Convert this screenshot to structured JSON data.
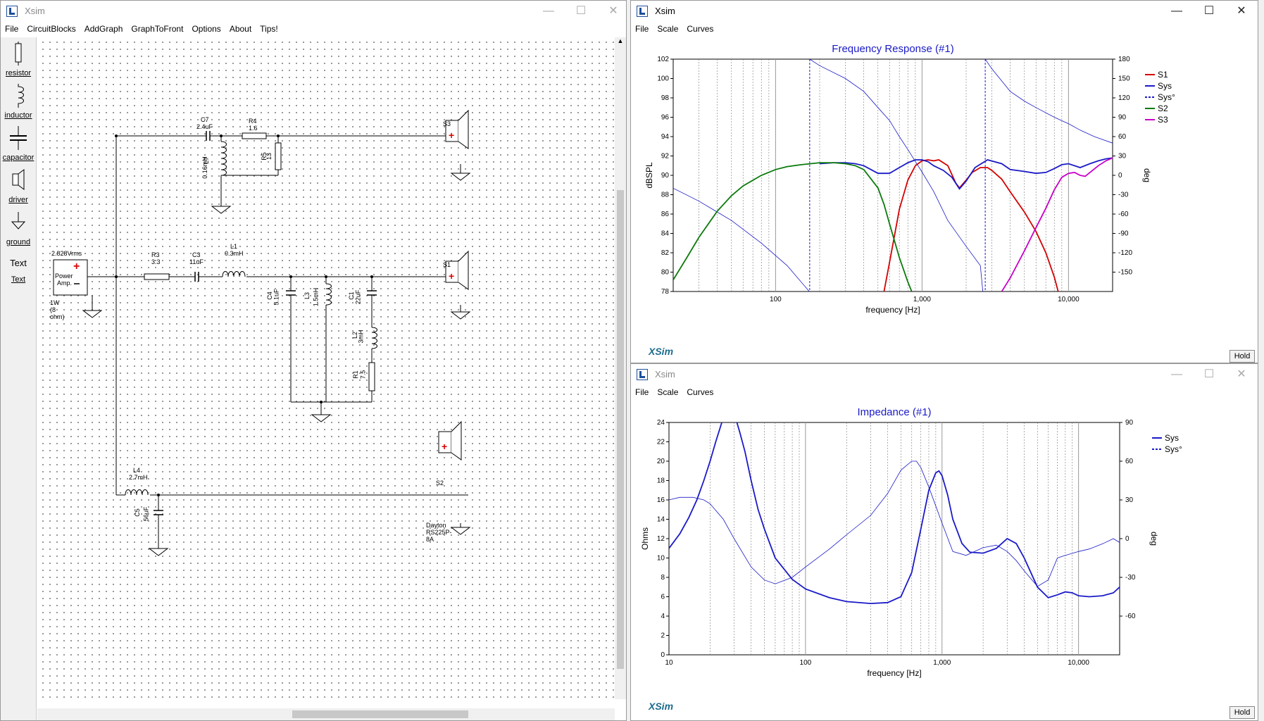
{
  "main_window": {
    "title": "Xsim",
    "menu": [
      "File",
      "CircuitBlocks",
      "AddGraph",
      "GraphToFront",
      "Options",
      "About",
      "Tips!"
    ]
  },
  "palette": [
    {
      "label": "resistor",
      "icon": "resistor-icon"
    },
    {
      "label": "inductor",
      "icon": "inductor-icon"
    },
    {
      "label": "capacitor",
      "icon": "capacitor-icon"
    },
    {
      "label": "driver",
      "icon": "driver-icon"
    },
    {
      "label": "ground",
      "icon": "ground-icon"
    },
    {
      "label": "Text",
      "icon": "text-icon",
      "glyph": "Text"
    }
  ],
  "circuit": {
    "source": {
      "voltage": "2.828Vrms",
      "name_line1": "Power",
      "name_line2": "Amp.",
      "note": "1W (8 ohm)"
    },
    "components": {
      "C7": {
        "name": "C7",
        "value": "2.4uF"
      },
      "R4": {
        "name": "R4",
        "value": "1.6"
      },
      "L7": {
        "name": "L7",
        "value": "0.16mH"
      },
      "R5": {
        "name": "R5",
        "value": "13"
      },
      "R3": {
        "name": "R3",
        "value": "3.3"
      },
      "C3": {
        "name": "C3",
        "value": "11uF"
      },
      "L1": {
        "name": "L1",
        "value": "0.3mH"
      },
      "C4": {
        "name": "C4",
        "value": "5.1uF"
      },
      "L3": {
        "name": "L3",
        "value": "1.5mH"
      },
      "C1": {
        "name": "C1",
        "value": "22uF"
      },
      "L2": {
        "name": "L2",
        "value": "3mH"
      },
      "R1": {
        "name": "R1",
        "value": "7.5"
      },
      "L4": {
        "name": "L4",
        "value": "2.7mH"
      },
      "C5": {
        "name": "C5",
        "value": "56uF"
      }
    },
    "drivers": {
      "S1": "S1",
      "S2": "S2",
      "S3": "S3",
      "s2_model": "Dayton RS225P-8A"
    }
  },
  "freq_window": {
    "title": "Xsim",
    "menu": [
      "File",
      "Scale",
      "Curves"
    ],
    "hold_label": "Hold",
    "logo": "XSim"
  },
  "imp_window": {
    "title": "Xsim",
    "menu": [
      "File",
      "Scale",
      "Curves"
    ],
    "hold_label": "Hold",
    "logo": "XSim"
  },
  "chart_data": [
    {
      "type": "line",
      "title": "Frequency Response (#1)",
      "xlabel": "frequency [Hz]",
      "ylabel": "dBSPL",
      "y2label": "deg",
      "x_scale": "log",
      "xlim": [
        20,
        20000
      ],
      "ylim": [
        78,
        102
      ],
      "y2lim": [
        -180,
        180
      ],
      "x_ticks": [
        "100",
        "1,000",
        "10,000"
      ],
      "y_ticks": [
        "78",
        "80",
        "82",
        "84",
        "86",
        "88",
        "90",
        "92",
        "94",
        "96",
        "98",
        "100",
        "102"
      ],
      "y2_ticks": [
        "-150",
        "-120",
        "-90",
        "-60",
        "-30",
        "0",
        "30",
        "60",
        "90",
        "120",
        "150",
        "180"
      ],
      "legend_position": "right",
      "series": [
        {
          "name": "S1",
          "color": "#d40000",
          "axis": "left",
          "x": [
            550,
            600,
            700,
            800,
            900,
            1000,
            1100,
            1200,
            1300,
            1500,
            1700,
            1800,
            2000,
            2200,
            2500,
            2800,
            3000,
            3500,
            4000,
            5000,
            6000,
            7000,
            8000,
            8500
          ],
          "values": [
            78,
            81,
            86.5,
            89.5,
            91,
            91.5,
            91.6,
            91.5,
            91.6,
            91,
            89.2,
            88.7,
            89.5,
            90.3,
            90.8,
            90.8,
            90.5,
            89.6,
            88.3,
            86.2,
            84.2,
            82,
            79.5,
            78
          ]
        },
        {
          "name": "Sys",
          "color": "#1a1ac8",
          "axis": "left",
          "x": [
            200,
            250,
            300,
            350,
            400,
            500,
            600,
            700,
            800,
            900,
            1000,
            1100,
            1200,
            1400,
            1600,
            1800,
            2000,
            2300,
            2800,
            3500,
            4000,
            5000,
            6000,
            7000,
            8000,
            9000,
            10000,
            12000,
            14000,
            16000,
            18000,
            20000
          ],
          "values": [
            91.2,
            91.3,
            91.3,
            91.2,
            91,
            90.2,
            90.2,
            90.8,
            91.3,
            91.6,
            91.6,
            91.4,
            91,
            90.5,
            89.8,
            88.6,
            89.4,
            90.8,
            91.6,
            91.2,
            90.6,
            90.4,
            90.2,
            90.3,
            90.7,
            91.1,
            91.2,
            90.8,
            91.2,
            91.5,
            91.7,
            91.8
          ]
        },
        {
          "name": "Sys°",
          "color": "#1a1ac8",
          "axis": "right",
          "dashed": true,
          "x": [
            20,
            30,
            50,
            80,
            120,
            170,
            171,
            200,
            300,
            400,
            500,
            600,
            700,
            800,
            1000,
            1200,
            1500,
            2000,
            2500,
            2600,
            2700,
            3000,
            4000,
            5000,
            6000,
            8000,
            10000,
            12000,
            15000,
            20000
          ],
          "values": [
            -20,
            -40,
            -70,
            -105,
            -140,
            -180,
            180,
            170,
            150,
            130,
            105,
            85,
            60,
            40,
            5,
            -25,
            -70,
            -110,
            -140,
            -180,
            180,
            165,
            130,
            115,
            105,
            90,
            80,
            70,
            60,
            50
          ]
        },
        {
          "name": "S2",
          "color": "#0b7a0b",
          "axis": "left",
          "x": [
            20,
            25,
            30,
            40,
            50,
            60,
            80,
            100,
            120,
            150,
            200,
            250,
            300,
            350,
            400,
            500,
            550,
            600,
            700,
            800,
            850
          ],
          "values": [
            79.2,
            81.6,
            83.6,
            86.3,
            87.9,
            88.9,
            90,
            90.6,
            90.9,
            91.1,
            91.3,
            91.3,
            91.2,
            91,
            90.6,
            88.7,
            87,
            85,
            81.5,
            79,
            78
          ]
        },
        {
          "name": "S3",
          "color": "#c800c8",
          "axis": "left",
          "x": [
            3500,
            4000,
            5000,
            6000,
            7000,
            8000,
            9000,
            10000,
            11000,
            12000,
            13000,
            14000,
            16000,
            18000,
            20000
          ],
          "values": [
            78,
            79.4,
            82.2,
            84.6,
            86.6,
            88.5,
            89.8,
            90.2,
            90.3,
            90,
            89.9,
            90.3,
            91,
            91.5,
            91.8
          ]
        }
      ]
    },
    {
      "type": "line",
      "title": "Impedance (#1)",
      "xlabel": "frequency [Hz]",
      "ylabel": "Ohms",
      "y2label": "deg",
      "x_scale": "log",
      "xlim": [
        10,
        20000
      ],
      "ylim": [
        0,
        24
      ],
      "y2lim": [
        -90,
        90
      ],
      "x_ticks": [
        "10",
        "100",
        "1,000",
        "10,000"
      ],
      "y_ticks": [
        "0",
        "2",
        "4",
        "6",
        "8",
        "10",
        "12",
        "14",
        "16",
        "18",
        "20",
        "22",
        "24"
      ],
      "y2_ticks": [
        "-60",
        "-30",
        "0",
        "30",
        "60",
        "90"
      ],
      "legend_position": "right",
      "series": [
        {
          "name": "Sys",
          "color": "#1a1ac8",
          "axis": "left",
          "x": [
            10,
            12,
            14,
            16,
            18,
            20,
            22,
            25,
            28,
            30,
            33,
            36,
            40,
            45,
            50,
            60,
            80,
            100,
            150,
            200,
            300,
            400,
            500,
            600,
            700,
            800,
            900,
            950,
            1000,
            1100,
            1200,
            1400,
            1600,
            2000,
            2500,
            3000,
            3500,
            4000,
            5000,
            6000,
            7000,
            8000,
            9000,
            10000,
            12000,
            15000,
            18000,
            20000
          ],
          "values": [
            11,
            12.5,
            14.2,
            16,
            18,
            20,
            22,
            24.5,
            26,
            25,
            23,
            21,
            18,
            15,
            13,
            10,
            7.8,
            6.8,
            5.9,
            5.5,
            5.3,
            5.4,
            6,
            8.5,
            13,
            17,
            18.8,
            19,
            18.5,
            16.5,
            14,
            11.5,
            10.6,
            10.5,
            11,
            12,
            11.5,
            10,
            7,
            5.9,
            6.2,
            6.5,
            6.4,
            6.1,
            6,
            6.1,
            6.4,
            7
          ]
        },
        {
          "name": "Sys°",
          "color": "#1a1ac8",
          "axis": "right",
          "dashed": true,
          "x": [
            10,
            12,
            15,
            18,
            20,
            25,
            30,
            40,
            50,
            60,
            80,
            100,
            150,
            200,
            300,
            400,
            500,
            600,
            650,
            700,
            800,
            1000,
            1200,
            1500,
            2000,
            2500,
            3000,
            3500,
            4000,
            5000,
            6000,
            7000,
            8000,
            10000,
            12000,
            15000,
            18000,
            20000
          ],
          "values": [
            30,
            32,
            32,
            30,
            27,
            15,
            0,
            -22,
            -32,
            -35,
            -30,
            -22,
            -8,
            3,
            18,
            35,
            53,
            60,
            60,
            55,
            40,
            12,
            -10,
            -13,
            -7,
            -5,
            -10,
            -17,
            -25,
            -37,
            -32,
            -15,
            -13,
            -10,
            -8,
            -4,
            0,
            -3
          ]
        }
      ]
    }
  ]
}
